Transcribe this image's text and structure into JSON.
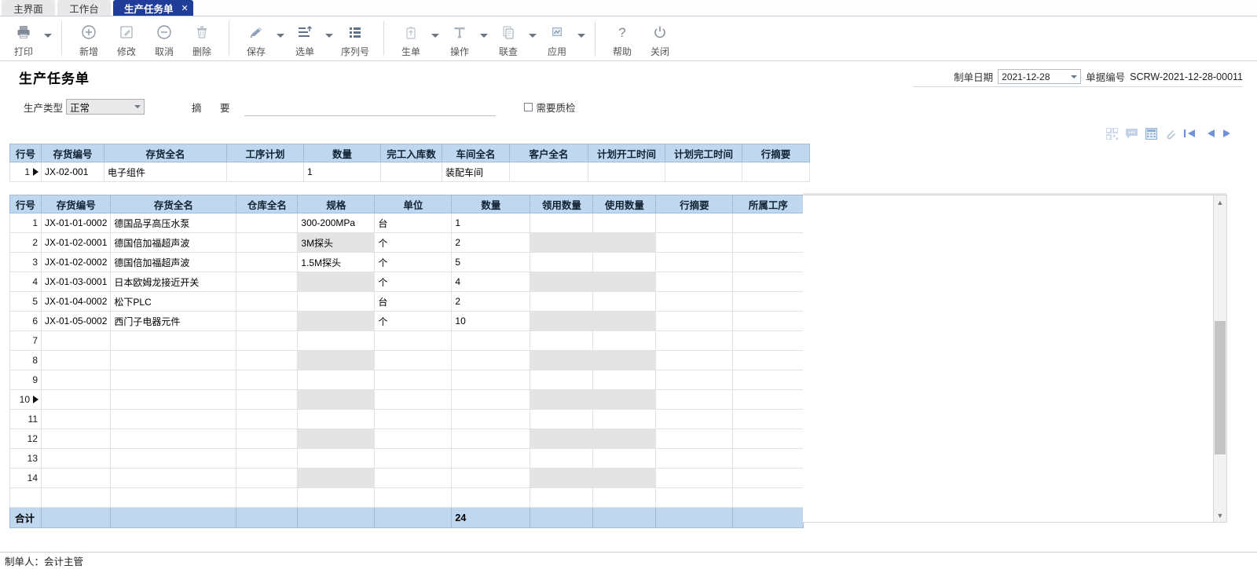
{
  "tabs": [
    {
      "label": "主界面",
      "active": false
    },
    {
      "label": "工作台",
      "active": false
    },
    {
      "label": "生产任务单",
      "active": true,
      "close": "✕"
    }
  ],
  "toolbar": {
    "groups": [
      {
        "buttons": [
          {
            "label": "打印",
            "icon": "printer-icon",
            "caret": true
          }
        ]
      },
      {
        "buttons": [
          {
            "label": "新增",
            "icon": "plus-circle-icon",
            "caret": false
          },
          {
            "label": "修改",
            "icon": "edit-pencil-icon",
            "caret": false
          },
          {
            "label": "取消",
            "icon": "minus-circle-icon",
            "caret": false
          },
          {
            "label": "删除",
            "icon": "trash-icon",
            "caret": false
          }
        ]
      },
      {
        "buttons": [
          {
            "label": "保存",
            "icon": "save-pen-icon",
            "caret": true
          },
          {
            "label": "选单",
            "icon": "select-list-icon",
            "caret": true
          },
          {
            "label": "序列号",
            "icon": "serial-list-icon",
            "caret": false
          }
        ]
      },
      {
        "buttons": [
          {
            "label": "生单",
            "icon": "generate-doc-icon",
            "caret": true
          },
          {
            "label": "操作",
            "icon": "operation-icon",
            "caret": true
          },
          {
            "label": "联查",
            "icon": "linked-query-icon",
            "caret": true
          },
          {
            "label": "应用",
            "icon": "apply-grid-icon",
            "caret": true
          }
        ]
      },
      {
        "buttons": [
          {
            "label": "帮助",
            "icon": "question-mark-icon",
            "caret": false
          },
          {
            "label": "关闭",
            "icon": "power-icon",
            "caret": false
          }
        ]
      }
    ]
  },
  "header": {
    "title": "生产任务单",
    "date_label": "制单日期",
    "date_value": "2021-12-28",
    "docno_label": "单据编号",
    "docno_value": "SCRW-2021-12-28-00011"
  },
  "filters": {
    "type_label": "生产类型",
    "type_value": "正常",
    "summary_label": "摘  要",
    "summary_value": "",
    "qc_label": "需要质检",
    "qc_checked": false
  },
  "icon_strip": [
    {
      "name": "qrcode-icon"
    },
    {
      "name": "comment-icon"
    },
    {
      "name": "calculator-icon"
    },
    {
      "name": "attachment-icon"
    },
    {
      "name": "first-record-icon"
    },
    {
      "name": "prev-record-icon"
    },
    {
      "name": "next-record-icon"
    },
    {
      "name": "last-record-icon"
    }
  ],
  "grid_main": {
    "columns": [
      "行号",
      "存货编号",
      "存货全名",
      "工序计划",
      "数量",
      "完工入库数",
      "车间全名",
      "客户全名",
      "计划开工时间",
      "计划完工时间",
      "行摘要"
    ],
    "rows": [
      {
        "row": "1",
        "pointer": true,
        "cells": [
          "JX-02-001",
          "电子组件",
          "",
          "1",
          "",
          "装配车间",
          "",
          "",
          "",
          ""
        ],
        "readonly": [
          false,
          false,
          true,
          false,
          true,
          false,
          false,
          false,
          false,
          false
        ],
        "selected_index": 5
      }
    ]
  },
  "grid_detail": {
    "columns": [
      "行号",
      "存货编号",
      "存货全名",
      "仓库全名",
      "规格",
      "单位",
      "数量",
      "领用数量",
      "使用数量",
      "行摘要",
      "所属工序"
    ],
    "rows": [
      {
        "row": "1",
        "pointer": false,
        "cells": [
          "JX-01-01-0002",
          "德国品孚高压水泵",
          "",
          "300-200MPa",
          "台",
          "1",
          "",
          "",
          "",
          ""
        ]
      },
      {
        "row": "2",
        "pointer": false,
        "cells": [
          "JX-01-02-0001",
          "德国倍加福超声波",
          "",
          "3M探头",
          "个",
          "2",
          "",
          "",
          "",
          ""
        ]
      },
      {
        "row": "3",
        "pointer": false,
        "cells": [
          "JX-01-02-0002",
          "德国倍加福超声波",
          "",
          "1.5M探头",
          "个",
          "5",
          "",
          "",
          "",
          ""
        ]
      },
      {
        "row": "4",
        "pointer": false,
        "cells": [
          "JX-01-03-0001",
          "日本欧姆龙接近开关",
          "",
          "",
          "个",
          "4",
          "",
          "",
          "",
          ""
        ]
      },
      {
        "row": "5",
        "pointer": false,
        "cells": [
          "JX-01-04-0002",
          "松下PLC",
          "",
          "",
          "台",
          "2",
          "",
          "",
          "",
          ""
        ]
      },
      {
        "row": "6",
        "pointer": false,
        "cells": [
          "JX-01-05-0002",
          "西门子电器元件",
          "",
          "",
          "个",
          "10",
          "",
          "",
          "",
          ""
        ]
      },
      {
        "row": "7",
        "pointer": false,
        "cells": [
          "",
          "",
          "",
          "",
          "",
          "",
          "",
          "",
          "",
          ""
        ]
      },
      {
        "row": "8",
        "pointer": false,
        "cells": [
          "",
          "",
          "",
          "",
          "",
          "",
          "",
          "",
          "",
          ""
        ]
      },
      {
        "row": "9",
        "pointer": false,
        "cells": [
          "",
          "",
          "",
          "",
          "",
          "",
          "",
          "",
          "",
          ""
        ]
      },
      {
        "row": "10",
        "pointer": true,
        "cells": [
          "",
          "",
          "",
          "",
          "",
          "",
          "",
          "",
          "",
          ""
        ],
        "selected_index": 5
      },
      {
        "row": "11",
        "pointer": false,
        "cells": [
          "",
          "",
          "",
          "",
          "",
          "",
          "",
          "",
          "",
          ""
        ]
      },
      {
        "row": "12",
        "pointer": false,
        "cells": [
          "",
          "",
          "",
          "",
          "",
          "",
          "",
          "",
          "",
          ""
        ]
      },
      {
        "row": "13",
        "pointer": false,
        "cells": [
          "",
          "",
          "",
          "",
          "",
          "",
          "",
          "",
          "",
          ""
        ]
      },
      {
        "row": "14",
        "pointer": false,
        "cells": [
          "",
          "",
          "",
          "",
          "",
          "",
          "",
          "",
          "",
          ""
        ]
      }
    ],
    "total_label": "合计",
    "total_qty": "24"
  },
  "footer": {
    "text": "制单人：会计主管"
  },
  "colors": {
    "tab_active_bg": "#1f3d99",
    "header_bg": "#bfd8ef",
    "rownum_bg": "#d9eaf7",
    "selected_cell": "#7394b5",
    "readonly_cell": "#e4e4e4"
  }
}
